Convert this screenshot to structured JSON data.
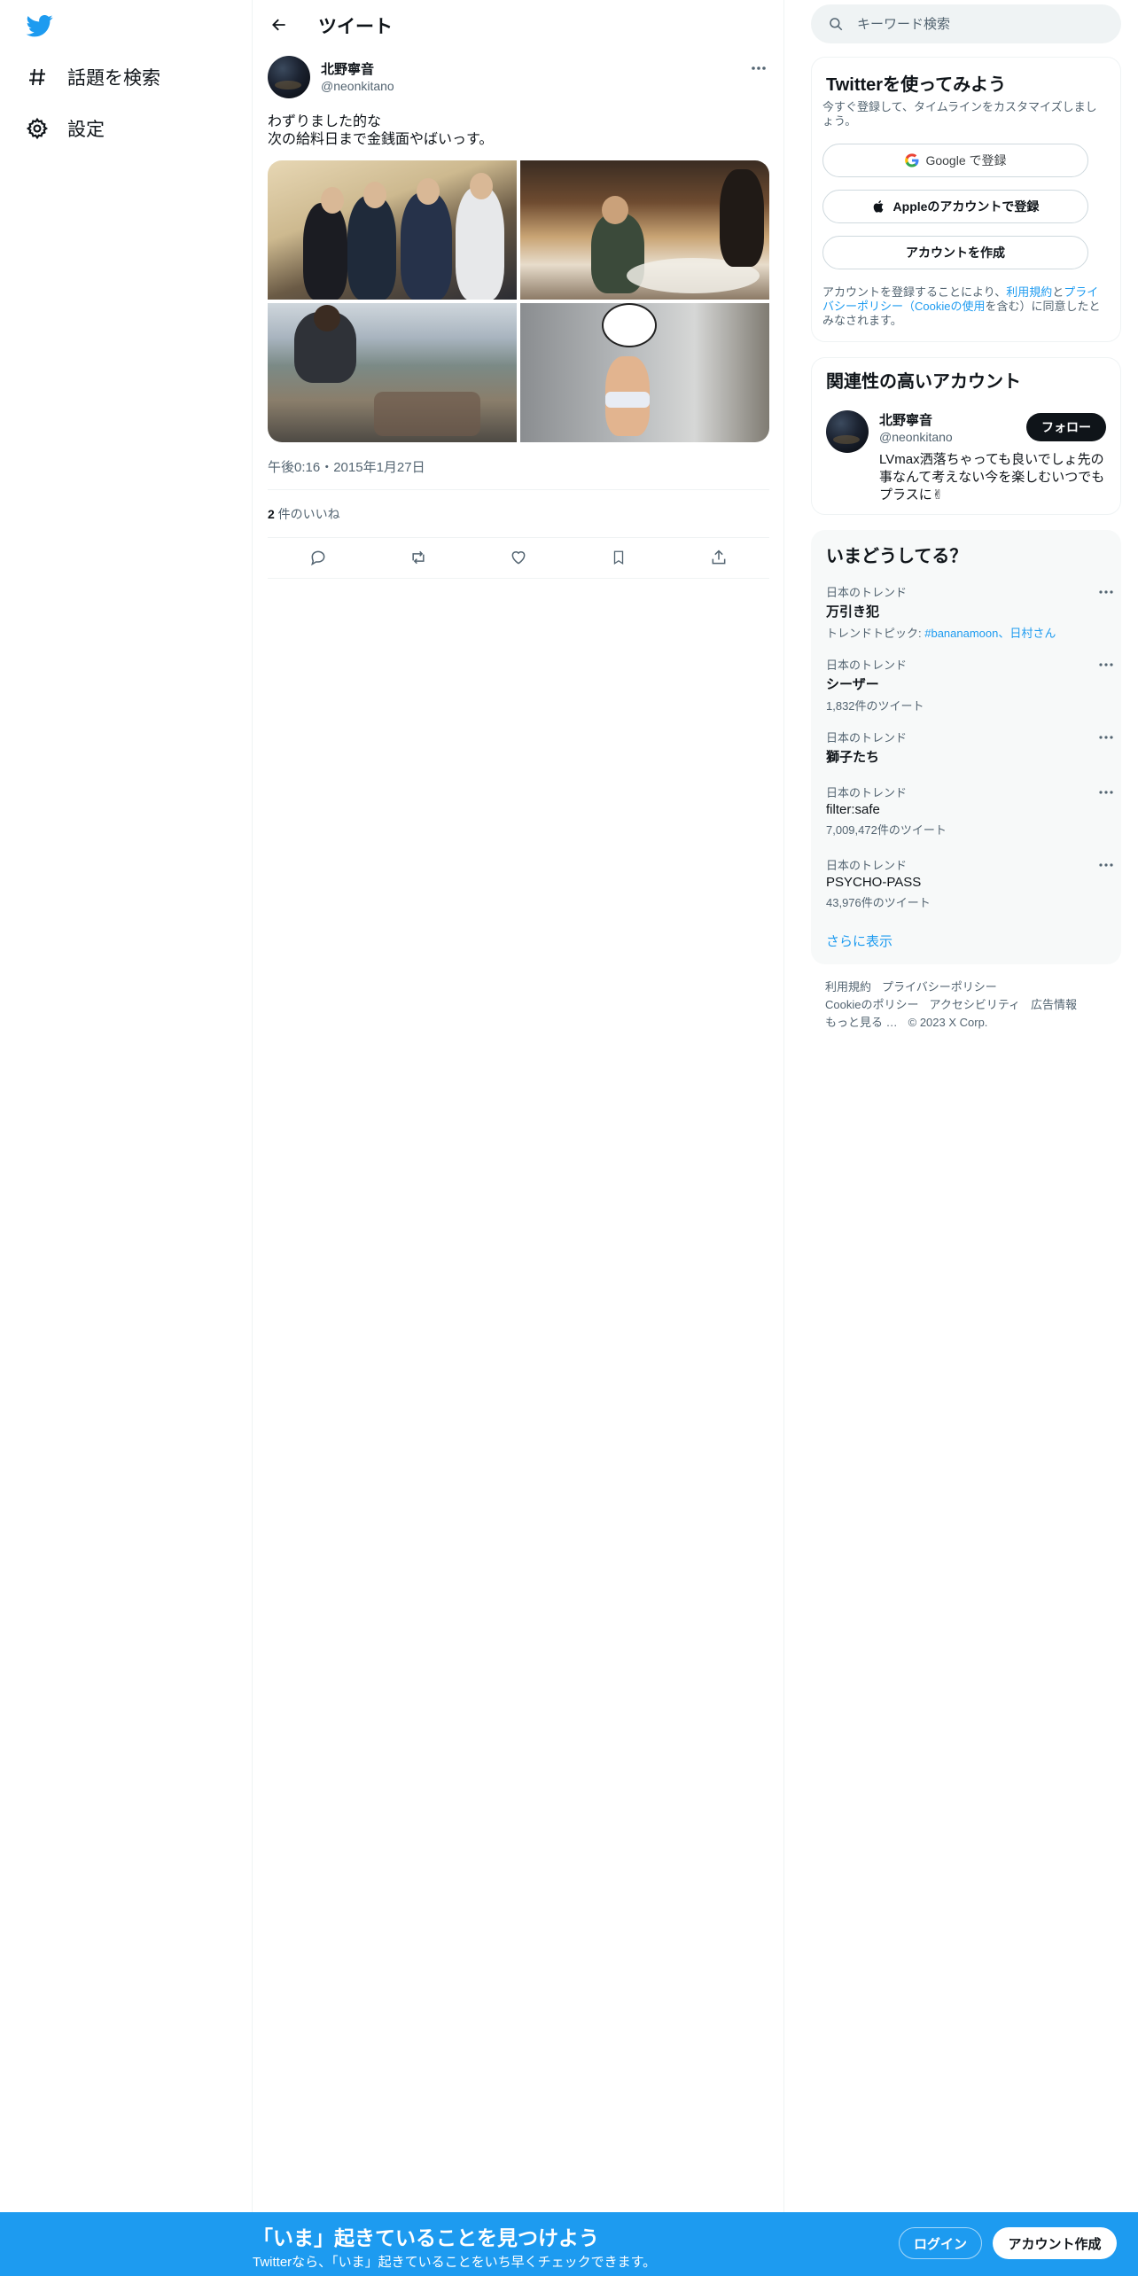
{
  "nav": {
    "items": [
      {
        "label": "話題を検索",
        "icon": "hashtag-icon"
      },
      {
        "label": "設定",
        "icon": "gear-icon"
      }
    ]
  },
  "header": {
    "title": "ツイート"
  },
  "tweet": {
    "author_name": "北野寧音",
    "author_handle": "@neonkitano",
    "text_line1": "わずりました的な",
    "text_line2": "次の給料日まで金銭面やばいっす。",
    "timestamp": "午後0:16・2015年1月27日",
    "likes_count": "2",
    "likes_label": " 件のいいね"
  },
  "search": {
    "placeholder": "キーワード検索"
  },
  "signup": {
    "title": "Twitterを使ってみよう",
    "subtitle": "今すぐ登録して、タイムラインをカスタマイズしましょう。",
    "google_button": "Google で登録",
    "apple_button": "Appleのアカウントで登録",
    "create_button": "アカウントを作成",
    "terms_prefix": "アカウントを登録することにより、",
    "terms_link": "利用規約",
    "terms_and": "と",
    "privacy_link": "プライバシーポリシー",
    "cookie_open": "（",
    "cookie_link": "Cookieの使用",
    "terms_suffix": "を含む）に同意したとみなされます。"
  },
  "related": {
    "title": "関連性の高いアカウント",
    "name": "北野寧音",
    "handle": "@neonkitano",
    "follow_label": "フォロー",
    "bio": "LVmax洒落ちゃっても良いでしょ先の事なんて考えない今を楽しむいつでもプラスに✌"
  },
  "trends": {
    "title": "いまどうしてる？",
    "items": [
      {
        "context": "日本のトレンド",
        "name": "万引き犯",
        "meta_prefix": "トレンドトピック: ",
        "meta_link": "#bananamoon、日村さん"
      },
      {
        "context": "日本のトレンド",
        "name": "シーザー",
        "meta": "1,832件のツイート"
      },
      {
        "context": "日本のトレンド",
        "name": "獅子たち",
        "meta": ""
      },
      {
        "context": "日本のトレンド",
        "name": "filter:safe",
        "meta": "7,009,472件のツイート"
      },
      {
        "context": "日本のトレンド",
        "name": "PSYCHO-PASS",
        "meta": "43,976件のツイート"
      }
    ],
    "show_more": "さらに表示"
  },
  "footer": {
    "links": [
      "利用規約",
      "プライバシーポリシー",
      "Cookieのポリシー",
      "アクセシビリティ",
      "広告情報",
      "もっと見る …"
    ],
    "copyright": "© 2023 X Corp."
  },
  "bottom_bar": {
    "title": "「いま」起きていることを見つけよう",
    "subtitle": "Twitterなら、「いま」起きていることをいち早くチェックできます。",
    "login": "ログイン",
    "signup": "アカウント作成"
  },
  "colors": {
    "accent": "#1d9bf0",
    "text": "#0f1419",
    "muted": "#536471"
  }
}
